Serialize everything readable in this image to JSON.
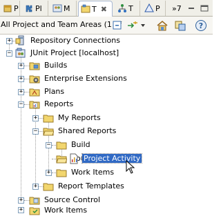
{
  "tabs": [
    {
      "label": "P",
      "icon": "package-icon"
    },
    {
      "label": "Pl",
      "icon": "plugins-icon"
    },
    {
      "label": "M",
      "icon": "team-icon"
    },
    {
      "label": "T",
      "icon": "team-artifacts-icon",
      "active": true,
      "close": "✖"
    },
    {
      "label": "T",
      "icon": "type-hierarchy-icon"
    },
    {
      "label": "P",
      "icon": "pending-changes-icon"
    }
  ],
  "overflow_label": "»7",
  "toolbar": {
    "scope": "All Project and Team Areas (1 of",
    "buttons": [
      "collapse-all-icon",
      "filter-icon",
      "dropdown-icon",
      "home-icon",
      "link-icon",
      "help-icon"
    ]
  },
  "tree": {
    "repository_connections": "Repository Connections",
    "project": "JUnit Project [localhost]",
    "builds": "Builds",
    "enterprise_extensions": "Enterprise Extensions",
    "plans": "Plans",
    "reports": "Reports",
    "my_reports": "My Reports",
    "shared_reports": "Shared Reports",
    "build": "Build",
    "source_control": "Source Control",
    "project_activity": "Project Activity",
    "work_items": "Work Items",
    "report_templates": "Report Templates",
    "source_control_top": "Source Control",
    "work_items_top": "Work Items"
  },
  "colors": {
    "selection": "#316ac5",
    "folder": "#f2d66e",
    "accent": "#0a58a8"
  }
}
